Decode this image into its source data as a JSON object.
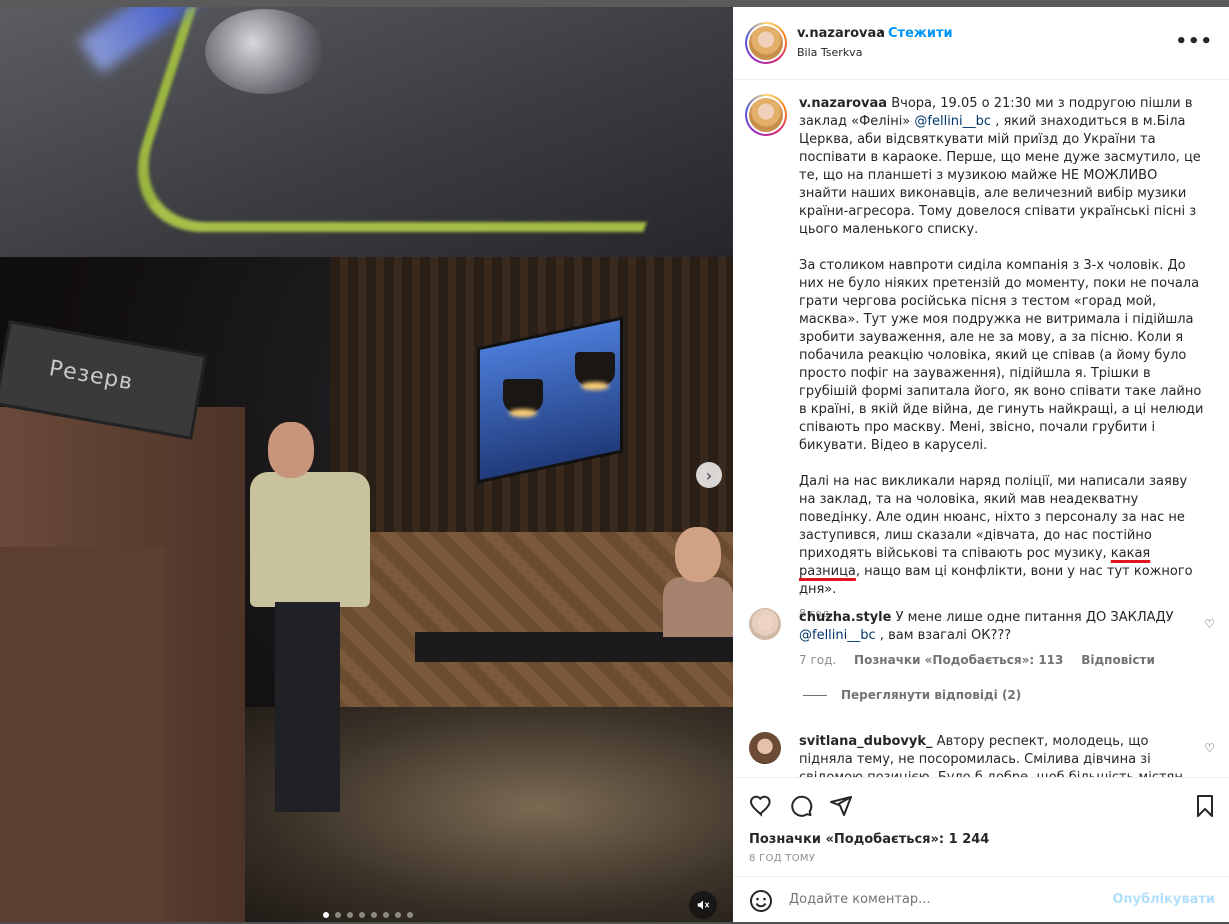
{
  "post": {
    "username": "v.nazarovaa",
    "follow_label": "Стежити",
    "location": "Bila Tserkva",
    "more_label": "•••"
  },
  "media": {
    "sign_text": "Резерв",
    "slide_count": 8,
    "active_slide": 1
  },
  "caption": {
    "username": "v.nazarovaa",
    "p1_a": "Вчора, 19.05 о 21:30 ми з подругою пішли в заклад «Феліні» ",
    "p1_mention": "@fellini__bc",
    "p1_b": " , який знаходиться в м.Біла Церква, аби відсвяткувати мій приїзд до України та поспівати в караоке. Перше, що мене дуже засмутило, це те, що на планшеті з музикою майже НЕ МОЖЛИВО знайти наших виконавців, але величезний вибір музики країни-агресора. Тому довелося співати українські пісні з цього маленького списку.",
    "p2": "За столиком навпроти сиділа компанія з 3-х чоловік. До них не було ніяких претензій до моменту, поки не почала грати чергова російська пісня з тестом «горад мой, масква». Тут уже моя подружка не витримала і підійшла зробити зауваження, але не за мову, а за пісню. Коли я побачила реакцію чоловіка, який це співав (а йому було просто пофіг на зауваження), підійшла я. Трішки в грубішій формі запитала його, як воно співати таке лайно в країні, в якій йде війна, де гинуть найкращі, а ці нелюди співають про маскву. Мені, звісно, почали грубити і бикувати. Відео в каруселі.",
    "p3_a": "Далі на нас викликали наряд поліції, ми написали заяву на заклад, та на чоловіка, який мав неадекватну поведінку. Але один нюанс, ніхто з персоналу за нас не заступився, лиш сказали «дівчата, до нас постійно приходять військові та співають рос музику, ",
    "p3_underlined": "какая разница",
    "p3_b": ", нащо вам ці конфлікти, вони у нас тут кожного дня».",
    "age": "8 год."
  },
  "comments": [
    {
      "username": "chuzha.style",
      "text_a": "У мене лише одне питання ДО ЗАКЛАДУ ",
      "mention": "@fellini__bc",
      "text_b": " , вам взагалі ОК???",
      "age": "7 год.",
      "likes": "Позначки «Подобається»: 113",
      "reply": "Відповісти",
      "view_replies": "Переглянути відповіді (2)"
    },
    {
      "username": "svitlana_dubovyk_",
      "text": "Автору респект, молодець, що підняла тему, не посоромилась. Смілива дівчина зі свідомою позицією. Було б добре, щоб більшість містян розуміли як"
    }
  ],
  "actions": {
    "likes": "Позначки «Подобається»: 1 244",
    "time": "8 ГОД ТОМУ",
    "comment_placeholder": "Додайте коментар...",
    "post_label": "Опублікувати"
  },
  "icons": [
    "heart-icon",
    "comment-icon",
    "share-icon",
    "bookmark-icon",
    "emoji-icon",
    "more-icon",
    "next-icon",
    "mute-icon"
  ],
  "colors": {
    "link": "#0095f6",
    "mention": "#00376b",
    "underline": "#e0141e",
    "post_disabled": "#b2dffc"
  }
}
